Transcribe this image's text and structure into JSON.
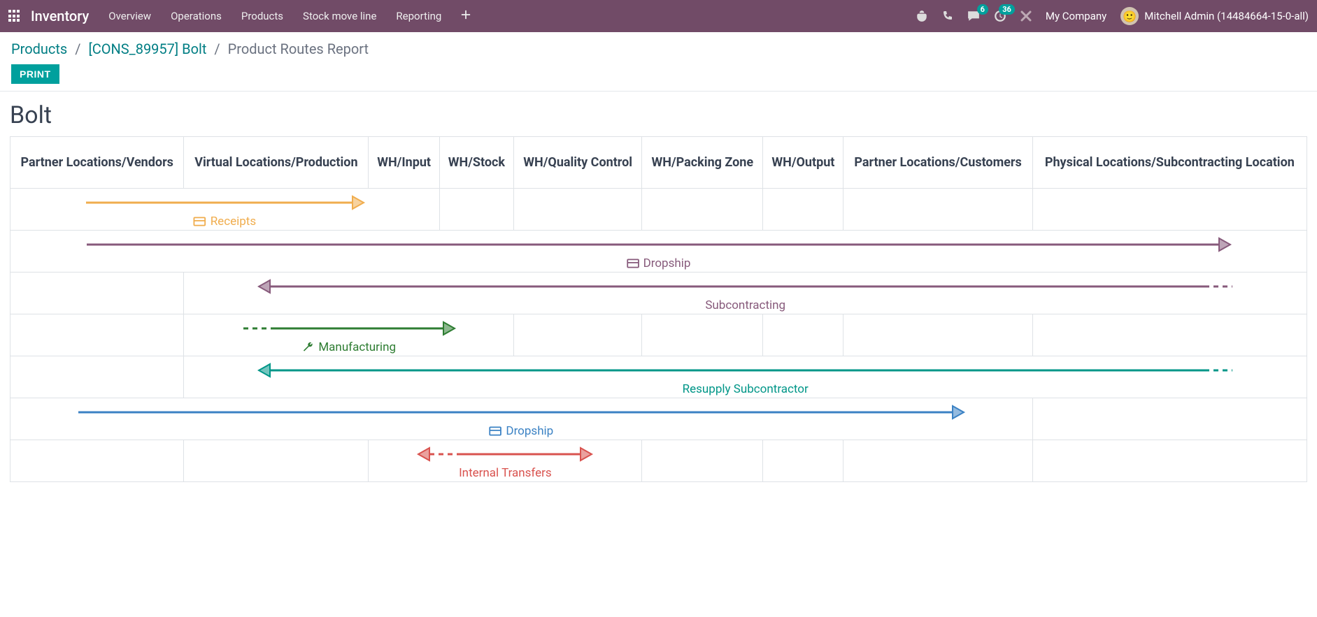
{
  "navbar": {
    "app": "Inventory",
    "menu": [
      "Overview",
      "Operations",
      "Products",
      "Stock move line",
      "Reporting"
    ],
    "messaging_badge": "6",
    "activities_badge": "36",
    "company": "My Company",
    "user": "Mitchell Admin (14484664-15-0-all)"
  },
  "breadcrumb": {
    "items": [
      {
        "label": "Products",
        "link": true
      },
      {
        "label": "[CONS_89957] Bolt",
        "link": true
      },
      {
        "label": "Product Routes Report",
        "link": false
      }
    ]
  },
  "buttons": {
    "print": "PRINT"
  },
  "report": {
    "title": "Bolt",
    "columns": [
      "Partner Locations/Vendors",
      "Virtual Locations/Production",
      "WH/Input",
      "WH/Stock",
      "WH/Quality Control",
      "WH/Packing Zone",
      "WH/Output",
      "Partner Locations/Customers",
      "Physical Locations/Subcontracting Location"
    ],
    "routes": [
      {
        "label": "Receipts",
        "from_col": 0,
        "to_col": 2,
        "direction": "right",
        "color": "#F0AD4E",
        "icon": "card",
        "start_dashed": false
      },
      {
        "label": "Dropship",
        "from_col": 0,
        "to_col": 8,
        "direction": "right",
        "color": "#875A7B",
        "icon": "card",
        "start_dashed": false
      },
      {
        "label": "Subcontracting",
        "from_col": 1,
        "to_col": 8,
        "direction": "left",
        "color": "#875A7B",
        "icon": null,
        "start_dashed": true
      },
      {
        "label": "Manufacturing",
        "from_col": 1,
        "to_col": 3,
        "direction": "right",
        "color": "#2E7D32",
        "icon": "wrench",
        "start_dashed": true
      },
      {
        "label": "Resupply Subcontractor",
        "from_col": 1,
        "to_col": 8,
        "direction": "left",
        "color": "#009688",
        "icon": null,
        "start_dashed": true
      },
      {
        "label": "Dropship",
        "from_col": 0,
        "to_col": 7,
        "direction": "right",
        "color": "#3B82C4",
        "icon": "card",
        "start_dashed": false
      },
      {
        "label": "Internal Transfers",
        "from_col": 2,
        "to_col": 4,
        "direction": "both",
        "color": "#D9534F",
        "icon": null,
        "start_dashed": true
      }
    ]
  }
}
